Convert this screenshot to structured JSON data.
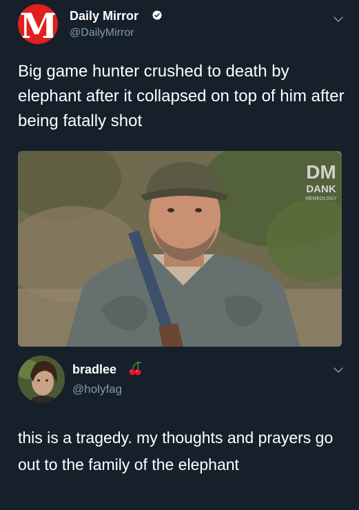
{
  "tweet": {
    "author_name": "Daily Mirror",
    "author_handle": "@DailyMirror",
    "avatar_letter": "M",
    "text": "Big game hunter crushed to death by elephant after it collapsed on top of him after being fatally shot",
    "verified": true,
    "photo": {
      "watermark_mark": "DM",
      "watermark_title": "DANK",
      "watermark_subtitle": "MEMEOLOGY"
    }
  },
  "reply": {
    "author_name": "bradlee",
    "author_handle": "@holyfag",
    "name_emoji": "cherries-icon",
    "text": "this is a tragedy. my thoughts and prayers go out to the family of the elephant"
  },
  "icons": {
    "menu": "chevron-down-icon",
    "verified": "verified-badge-icon"
  },
  "colors": {
    "background": "#15202b",
    "text_primary": "#ffffff",
    "text_secondary": "#8899a6",
    "brand_red": "#e0201c",
    "verified_blue": "#ffffff"
  }
}
